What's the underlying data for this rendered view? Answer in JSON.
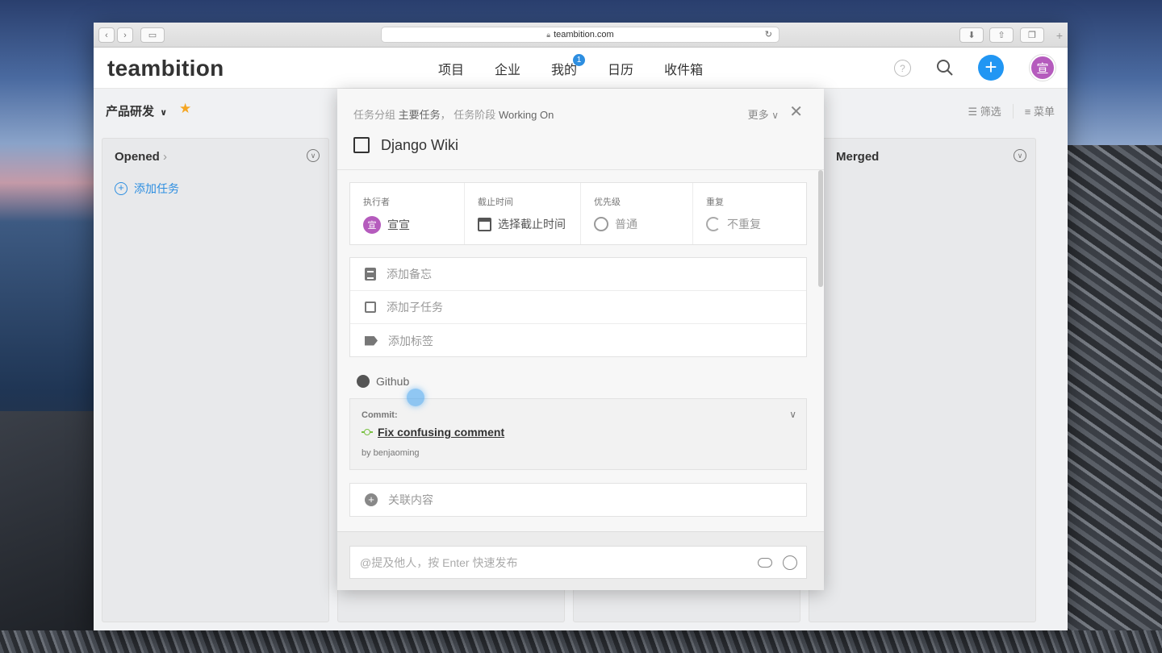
{
  "browser": {
    "url": "teambition.com",
    "lock_icon": "lock-icon"
  },
  "header": {
    "logo": "teambition",
    "nav": [
      {
        "label": "项目"
      },
      {
        "label": "企业"
      },
      {
        "label": "我的",
        "badge": "1"
      },
      {
        "label": "日历"
      },
      {
        "label": "收件箱"
      }
    ],
    "help": "?",
    "avatar": "宣"
  },
  "subheader": {
    "project": "产品研发",
    "filter": "筛选",
    "menu": "菜单"
  },
  "columns": [
    {
      "title": "Opened",
      "add_task": "添加任务"
    },
    {
      "title": ""
    },
    {
      "title": ""
    },
    {
      "title": "Merged"
    }
  ],
  "modal": {
    "crumb_group_label": "任务分组",
    "crumb_group": "主要任务",
    "crumb_sep": "，",
    "crumb_stage_label": "任务阶段",
    "crumb_stage": "Working On",
    "more": "更多",
    "task_title": "Django Wiki",
    "attrs": {
      "assignee_label": "执行者",
      "assignee_avatar": "宣",
      "assignee": "宣宣",
      "due_label": "截止时间",
      "due": "选择截止时间",
      "priority_label": "优先级",
      "priority": "普通",
      "repeat_label": "重复",
      "repeat": "不重复"
    },
    "list": [
      {
        "label": "添加备忘",
        "icon": "note-icon"
      },
      {
        "label": "添加子任务",
        "icon": "checkbox-icon"
      },
      {
        "label": "添加标签",
        "icon": "tag-icon"
      }
    ],
    "github": {
      "label": "Github",
      "commit_label": "Commit:",
      "commit_message": "Fix confusing comment",
      "commit_author": "by benjaoming"
    },
    "link_content": "关联内容",
    "comment_placeholder": "@提及他人，按 Enter 快速发布"
  },
  "colors": {
    "accent": "#2196f3",
    "link": "#2d8ee0",
    "star": "#f5a623",
    "avatar": "#b55bbd",
    "commit": "#7ac143"
  }
}
